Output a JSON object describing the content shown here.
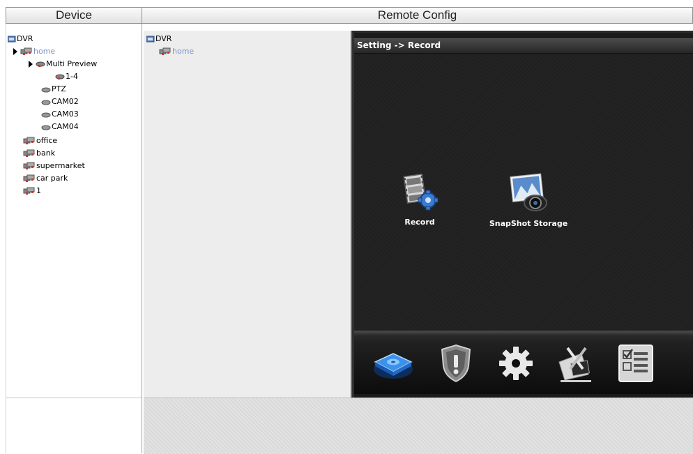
{
  "headers": {
    "device": "Device",
    "remote_config": "Remote Config"
  },
  "device_tree": [
    {
      "label": "DVR",
      "icon": "dvr-icon",
      "expanded": true
    },
    {
      "label": "home",
      "icon": "group-icon",
      "expanded": true,
      "selected": true
    },
    {
      "label": "Multi Preview",
      "icon": "camera-icon",
      "expanded": true
    },
    {
      "label": "1-4",
      "icon": "camera-icon"
    },
    {
      "label": "PTZ",
      "icon": "camera-icon"
    },
    {
      "label": "CAM02",
      "icon": "camera-icon"
    },
    {
      "label": "CAM03",
      "icon": "camera-icon"
    },
    {
      "label": "CAM04",
      "icon": "camera-icon"
    },
    {
      "label": "office",
      "icon": "group-icon"
    },
    {
      "label": "bank",
      "icon": "group-icon"
    },
    {
      "label": "supermarket",
      "icon": "group-icon"
    },
    {
      "label": "car park",
      "icon": "group-icon"
    },
    {
      "label": "1",
      "icon": "group-icon"
    }
  ],
  "remote_tree": [
    {
      "label": "DVR",
      "icon": "dvr-icon"
    },
    {
      "label": "home",
      "icon": "group-icon",
      "selected": true
    }
  ],
  "dvr": {
    "title": "Setting -> Record",
    "tiles": [
      {
        "label": "Record",
        "icon": "film-gear-icon"
      },
      {
        "label": "SnapShot Storage",
        "icon": "camera-photo-icon"
      }
    ],
    "dock": [
      "disk-icon",
      "shield-alert-icon",
      "gear-icon",
      "tools-icon",
      "checklist-icon"
    ]
  },
  "colors": {
    "link": "#7a95c8",
    "screen_bg": "#1b1b1b",
    "dock_disk_accent": "#2f86e0"
  }
}
